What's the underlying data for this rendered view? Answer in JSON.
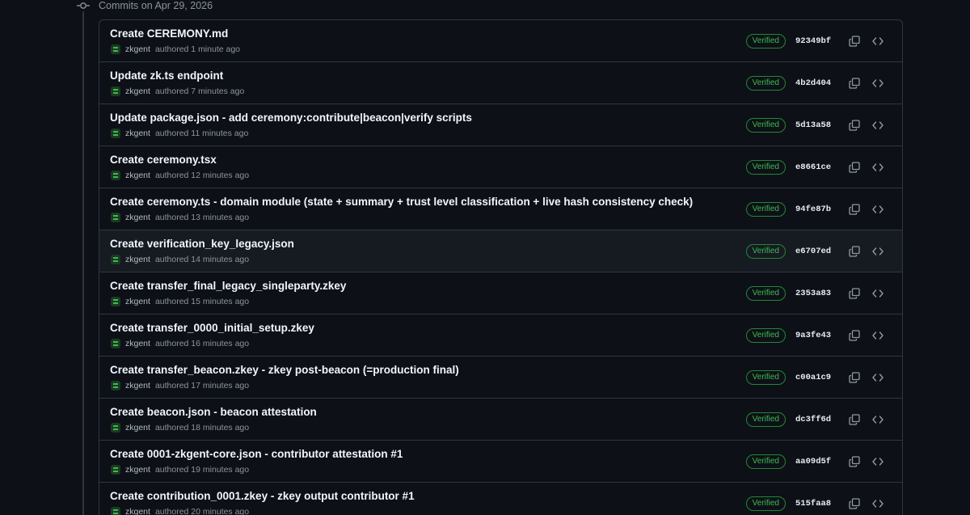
{
  "group": {
    "label": "Commits on Apr 29, 2026"
  },
  "commits": [
    {
      "title": "Create CEREMONY.md",
      "author": "zkgent",
      "meta": "authored 1 minute ago",
      "badge": "Verified",
      "sha": "92349bf"
    },
    {
      "title": "Update zk.ts endpoint",
      "author": "zkgent",
      "meta": "authored 7 minutes ago",
      "badge": "Verified",
      "sha": "4b2d404"
    },
    {
      "title": "Update package.json - add ceremony:contribute|beacon|verify scripts",
      "author": "zkgent",
      "meta": "authored 11 minutes ago",
      "badge": "Verified",
      "sha": "5d13a58"
    },
    {
      "title": "Create ceremony.tsx",
      "author": "zkgent",
      "meta": "authored 12 minutes ago",
      "badge": "Verified",
      "sha": "e8661ce"
    },
    {
      "title": "Create ceremony.ts - domain module (state + summary + trust level classification + live hash consistency check)",
      "author": "zkgent",
      "meta": "authored 13 minutes ago",
      "badge": "Verified",
      "sha": "94fe87b"
    },
    {
      "title": "Create verification_key_legacy.json",
      "author": "zkgent",
      "meta": "authored 14 minutes ago",
      "badge": "Verified",
      "sha": "e6707ed"
    },
    {
      "title": "Create transfer_final_legacy_singleparty.zkey",
      "author": "zkgent",
      "meta": "authored 15 minutes ago",
      "badge": "Verified",
      "sha": "2353a83"
    },
    {
      "title": "Create transfer_0000_initial_setup.zkey",
      "author": "zkgent",
      "meta": "authored 16 minutes ago",
      "badge": "Verified",
      "sha": "9a3fe43"
    },
    {
      "title": "Create transfer_beacon.zkey - zkey post-beacon (=production final)",
      "author": "zkgent",
      "meta": "authored 17 minutes ago",
      "badge": "Verified",
      "sha": "c00a1c9"
    },
    {
      "title": "Create beacon.json - beacon attestation",
      "author": "zkgent",
      "meta": "authored 18 minutes ago",
      "badge": "Verified",
      "sha": "dc3ff6d"
    },
    {
      "title": "Create 0001-zkgent-core.json - contributor attestation #1",
      "author": "zkgent",
      "meta": "authored 19 minutes ago",
      "badge": "Verified",
      "sha": "aa09d5f"
    },
    {
      "title": "Create contribution_0001.zkey - zkey output contributor #1",
      "author": "zkgent",
      "meta": "authored 20 minutes ago",
      "badge": "Verified",
      "sha": "515faa8"
    }
  ],
  "icons": {
    "node": "git-commit-icon",
    "avatar": "avatar",
    "copy": "copy-icon",
    "browse": "code-icon"
  },
  "colors": {
    "background": "#0d1117",
    "border": "#30363d",
    "verified": "#3fb950",
    "muted": "#8b949e",
    "row_hover": "#161b22"
  },
  "hover_row_index": 5
}
